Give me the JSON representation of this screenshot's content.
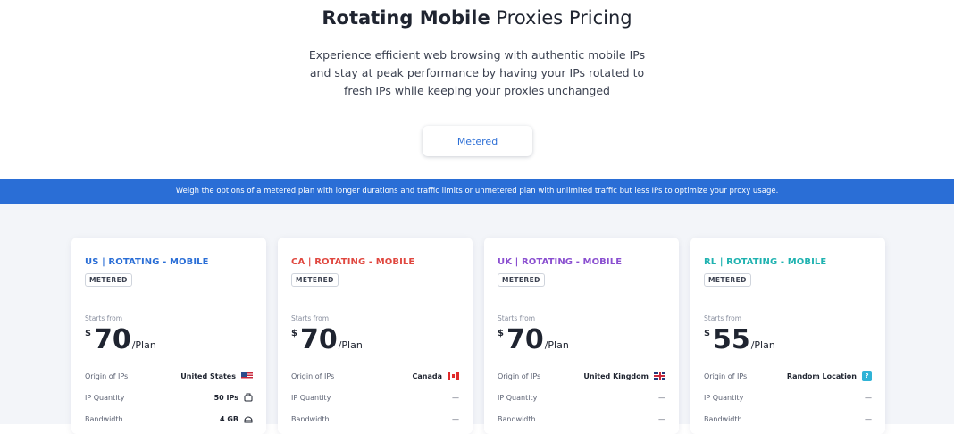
{
  "header": {
    "title_bold": "Rotating Mobile",
    "title_light": "Proxies Pricing",
    "subtitle": "Experience efficient web browsing with authentic mobile IPs and stay at peak performance by having your IPs rotated to fresh IPs while keeping your proxies unchanged",
    "toggle_label": "Metered"
  },
  "banner": {
    "text": "Weigh the options of a metered plan with longer durations and traffic limits or unmetered plan with unlimited traffic but less IPs to optimize your proxy usage."
  },
  "colors": {
    "accent": "#2a6ed6",
    "us": "#2a6ed6",
    "ca": "#e0473f",
    "uk": "#8a4fd0",
    "rl": "#1fb2b0"
  },
  "plans": [
    {
      "name": "US | ROTATING - MOBILE",
      "badge": "METERED",
      "starts_label": "Starts from",
      "currency": "$",
      "price": "70",
      "per": "/Plan",
      "origin_label": "Origin of IPs",
      "origin_value": "United States",
      "origin_icon": "us-flag-icon",
      "quantity_label": "IP Quantity",
      "quantity_value": "50 IPs",
      "bandwidth_label": "Bandwidth",
      "bandwidth_value": "4 GB"
    },
    {
      "name": "CA | ROTATING - MOBILE",
      "badge": "METERED",
      "starts_label": "Starts from",
      "currency": "$",
      "price": "70",
      "per": "/Plan",
      "origin_label": "Origin of IPs",
      "origin_value": "Canada",
      "origin_icon": "canada-flag-icon",
      "quantity_label": "IP Quantity",
      "quantity_value": "—",
      "bandwidth_label": "Bandwidth",
      "bandwidth_value": "—"
    },
    {
      "name": "UK | ROTATING - MOBILE",
      "badge": "METERED",
      "starts_label": "Starts from",
      "currency": "$",
      "price": "70",
      "per": "/Plan",
      "origin_label": "Origin of IPs",
      "origin_value": "United Kingdom",
      "origin_icon": "uk-flag-icon",
      "quantity_label": "IP Quantity",
      "quantity_value": "—",
      "bandwidth_label": "Bandwidth",
      "bandwidth_value": "—"
    },
    {
      "name": "RL | ROTATING - MOBILE",
      "badge": "METERED",
      "starts_label": "Starts from",
      "currency": "$",
      "price": "55",
      "per": "/Plan",
      "origin_label": "Origin of IPs",
      "origin_value": "Random Location",
      "origin_icon": "random-location-icon",
      "quantity_label": "IP Quantity",
      "quantity_value": "—",
      "bandwidth_label": "Bandwidth",
      "bandwidth_value": "—"
    }
  ]
}
